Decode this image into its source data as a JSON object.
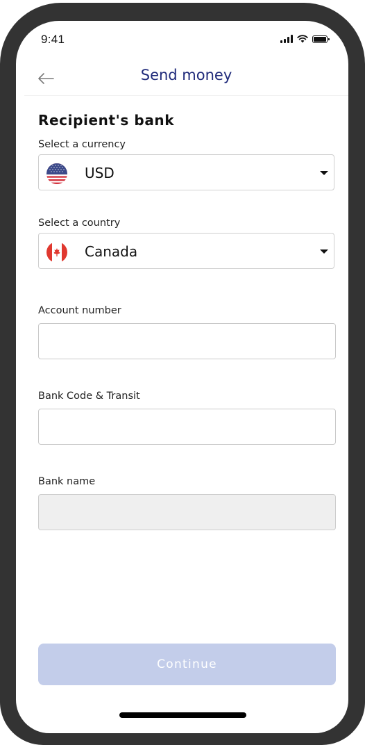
{
  "status_bar": {
    "time": "9:41",
    "icons": [
      "cellular-signal-icon",
      "wifi-icon",
      "battery-icon"
    ]
  },
  "nav": {
    "back_icon": "arrow-left-icon",
    "title": "Send money"
  },
  "form": {
    "section_title": "Recipient's bank",
    "currency": {
      "label": "Select a currency",
      "value": "USD",
      "flag_icon": "us-flag-icon"
    },
    "country": {
      "label": "Select a country",
      "value": "Canada",
      "flag_icon": "canada-flag-icon"
    },
    "account_number": {
      "label": "Account number",
      "value": "",
      "placeholder": ""
    },
    "bank_code": {
      "label": "Bank Code & Transit",
      "value": "",
      "placeholder": ""
    },
    "bank_name": {
      "label": "Bank name",
      "value": "",
      "placeholder": "",
      "disabled": true
    }
  },
  "actions": {
    "continue_label": "Continue",
    "continue_disabled": true
  },
  "colors": {
    "title": "#1f2a7a",
    "button_disabled": "#c3cdea",
    "frame": "#333333",
    "disabled_field": "#efefef"
  }
}
